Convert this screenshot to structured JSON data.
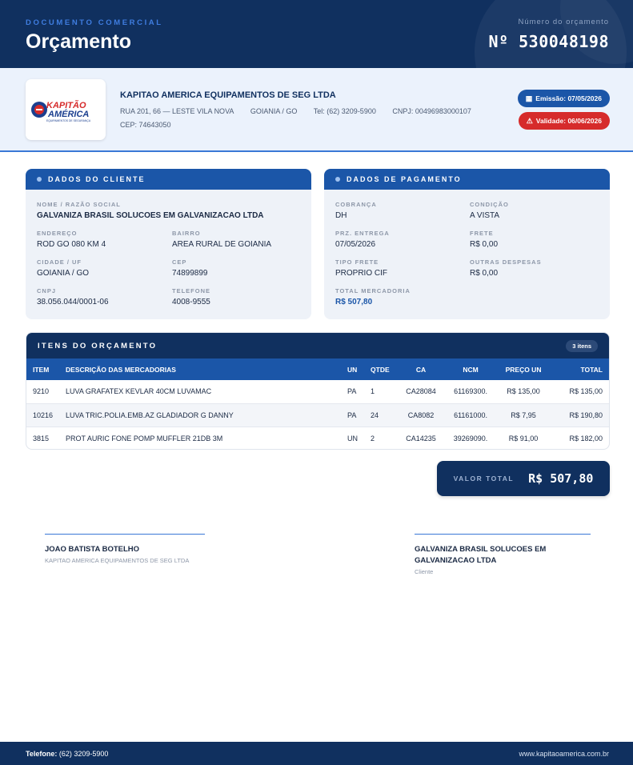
{
  "header": {
    "kicker": "DOCUMENTO COMERCIAL",
    "title": "Orçamento",
    "number_label": "Número do orçamento",
    "number_value": "Nº 530048198"
  },
  "company": {
    "logo_text_top": "KAPITÃO",
    "logo_text_bottom": "AMÉRICA",
    "logo_tagline": "EQUIPAMENTOS DE SEGURANÇA",
    "name": "KAPITAO AMERICA EQUIPAMENTOS DE SEG LTDA",
    "address": "RUA 201, 66 — LESTE VILA NOVA",
    "city": "GOIANIA / GO",
    "phone": "Tel: (62) 3209-5900",
    "cnpj": "CNPJ: 00496983000107",
    "cep": "CEP: 74643050",
    "emissao": "Emissão: 07/05/2026",
    "validade": "Validade: 06/06/2026"
  },
  "client_card": {
    "title": "DADOS DO CLIENTE",
    "nome_label": "NOME / RAZÃO SOCIAL",
    "nome": "GALVANIZA BRASIL SOLUCOES EM GALVANIZACAO LTDA",
    "endereco_label": "ENDEREÇO",
    "endereco": "ROD GO 080 KM 4",
    "bairro_label": "BAIRRO",
    "bairro": "AREA RURAL DE GOIANIA",
    "cidade_label": "CIDADE / UF",
    "cidade": "GOIANIA / GO",
    "cep_label": "CEP",
    "cep": "74899899",
    "cnpj_label": "CNPJ",
    "cnpj": "38.056.044/0001-06",
    "telefone_label": "TELEFONE",
    "telefone": "4008-9555"
  },
  "payment_card": {
    "title": "DADOS DE PAGAMENTO",
    "cobranca_label": "COBRANÇA",
    "cobranca": "DH",
    "condicao_label": "CONDIÇÃO",
    "condicao": "A VISTA",
    "entrega_label": "PRZ. ENTREGA",
    "entrega": "07/05/2026",
    "frete_label": "FRETE",
    "frete": "R$ 0,00",
    "tipo_frete_label": "TIPO FRETE",
    "tipo_frete": "PROPRIO CIF",
    "outras_label": "OUTRAS DESPESAS",
    "outras": "R$ 0,00",
    "total_merc_label": "TOTAL MERCADORIA",
    "total_merc": "R$ 507,80"
  },
  "items": {
    "title": "ITENS DO ORÇAMENTO",
    "count": "3 itens",
    "columns": [
      "ITEM",
      "DESCRIÇÃO DAS MERCADORIAS",
      "UN",
      "QTDE",
      "CA",
      "NCM",
      "PREÇO UN",
      "TOTAL"
    ],
    "rows": [
      [
        "9210",
        "LUVA GRAFATEX KEVLAR 40CM LUVAMAC",
        "PA",
        "1",
        "CA28084",
        "61169300.",
        "R$ 135,00",
        "R$ 135,00"
      ],
      [
        "10216",
        "LUVA TRIC.POLIA.EMB.AZ GLADIADOR G DANNY",
        "PA",
        "24",
        "CA8082",
        "61161000.",
        "R$ 7,95",
        "R$ 190,80"
      ],
      [
        "3815",
        "PROT AURIC FONE POMP MUFFLER 21DB 3M",
        "UN",
        "2",
        "CA14235",
        "39269090.",
        "R$ 91,00",
        "R$ 182,00"
      ]
    ]
  },
  "total": {
    "label": "VALOR TOTAL",
    "value": "R$ 507,80"
  },
  "signatures": {
    "left_name": "JOAO BATISTA BOTELHO",
    "left_role": "KAPITAO AMERICA EQUIPAMENTOS DE SEG LTDA",
    "right_name": "GALVANIZA BRASIL SOLUCOES EM GALVANIZACAO LTDA",
    "right_role": "Cliente"
  },
  "footer": {
    "phone_label": "Telefone:",
    "phone": "(62) 3209-5900",
    "site": "www.kapitaoamerica.com.br"
  },
  "colors": {
    "navy": "#10305f",
    "blue": "#1b56a8",
    "red": "#d62b2b",
    "light_bg": "#ebf2fc"
  },
  "icons": {
    "emissao": "calendar-icon",
    "validade": "warning-icon"
  }
}
